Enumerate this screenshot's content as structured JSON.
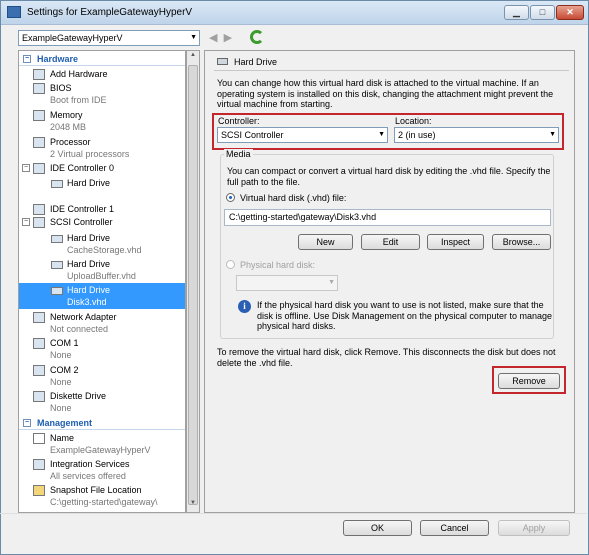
{
  "window": {
    "title": "Settings for ExampleGatewayHyperV"
  },
  "vm_selector": {
    "value": "ExampleGatewayHyperV"
  },
  "tree": {
    "hardware_header": "Hardware",
    "management_header": "Management",
    "items": [
      {
        "label": "Add Hardware",
        "sub": ""
      },
      {
        "label": "BIOS",
        "sub": "Boot from IDE"
      },
      {
        "label": "Memory",
        "sub": "2048 MB"
      },
      {
        "label": "Processor",
        "sub": "2 Virtual processors"
      },
      {
        "label": "IDE Controller 0",
        "sub": ""
      },
      {
        "label": "Hard Drive",
        "sub": ""
      },
      {
        "label": "IDE Controller 1",
        "sub": ""
      },
      {
        "label": "SCSI Controller",
        "sub": ""
      },
      {
        "label": "Hard Drive",
        "sub": "CacheStorage.vhd"
      },
      {
        "label": "Hard Drive",
        "sub": "UploadBuffer.vhd"
      },
      {
        "label": "Hard Drive",
        "sub": "Disk3.vhd"
      },
      {
        "label": "Network Adapter",
        "sub": "Not connected"
      },
      {
        "label": "COM 1",
        "sub": "None"
      },
      {
        "label": "COM 2",
        "sub": "None"
      },
      {
        "label": "Diskette Drive",
        "sub": "None"
      }
    ],
    "mgmt_items": [
      {
        "label": "Name",
        "sub": "ExampleGatewayHyperV"
      },
      {
        "label": "Integration Services",
        "sub": "All services offered"
      },
      {
        "label": "Snapshot File Location",
        "sub": "C:\\getting-started\\gateway\\"
      }
    ]
  },
  "panel": {
    "title": "Hard Drive",
    "intro": [
      "You can change how this virtual hard disk is attached to the virtual machine. If an",
      "operating system is installed on this disk, changing the attachment might prevent the",
      "virtual machine from starting."
    ],
    "controller_label": "Controller:",
    "controller_value": "SCSI Controller",
    "location_label": "Location:",
    "location_value": "2 (in use)",
    "media_label": "Media",
    "media_text": [
      "You can compact or convert a virtual hard disk by editing the .vhd file. Specify the",
      "full path to the file."
    ],
    "vhd_radio_label": "Virtual hard disk (.vhd) file:",
    "vhd_path": "C:\\getting-started\\gateway\\Disk3.vhd",
    "buttons": {
      "new": "New",
      "edit": "Edit",
      "inspect": "Inspect",
      "browse": "Browse..."
    },
    "physical_radio_label": "Physical hard disk:",
    "physical_info": [
      "If the physical hard disk you want to use is not listed, make sure that the",
      "disk is offline. Use Disk Management on the physical computer to manage",
      "physical hard disks."
    ],
    "remove_text": [
      "To remove the virtual hard disk, click Remove. This disconnects the disk but does not",
      "delete the .vhd file."
    ],
    "remove_button": "Remove"
  },
  "footer": {
    "ok": "OK",
    "cancel": "Cancel",
    "apply": "Apply"
  }
}
